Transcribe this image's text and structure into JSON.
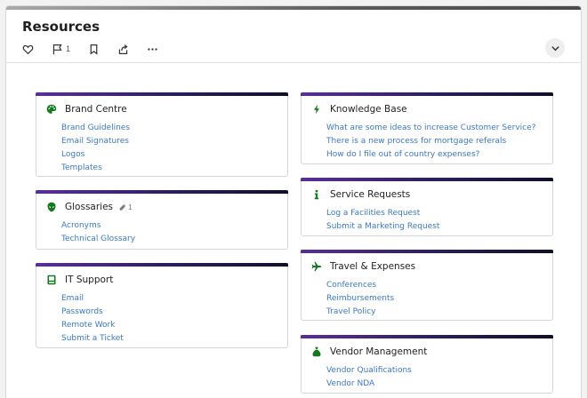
{
  "page": {
    "title": "Resources"
  },
  "actions": {
    "flag_count": "1"
  },
  "cards": {
    "brand": {
      "title": "Brand Centre",
      "links": [
        "Brand Guidelines",
        "Email Signatures",
        "Logos",
        "Templates"
      ]
    },
    "glossaries": {
      "title": "Glossaries",
      "attachment_count": "1",
      "links": [
        "Acronyms",
        "Technical Glossary"
      ]
    },
    "it": {
      "title": "IT Support",
      "links": [
        "Email",
        "Passwords",
        "Remote Work",
        "Submit a Ticket"
      ]
    },
    "knowledge": {
      "title": "Knowledge Base",
      "links": [
        "What are some ideas to increase Customer Service?",
        "There is a new process for mortgage referals",
        "How do I file out of country expenses?"
      ]
    },
    "service": {
      "title": "Service Requests",
      "links": [
        "Log a Facilities Request",
        "Submit a Marketing Request"
      ]
    },
    "travel": {
      "title": "Travel & Expenses",
      "links": [
        "Conferences",
        "Reimbursements",
        "Travel Policy"
      ]
    },
    "vendor": {
      "title": "Vendor Management",
      "links": [
        "Vendor Qualifications",
        "Vendor NDA"
      ]
    }
  },
  "colors": {
    "icon_green": "#137a1c",
    "link_blue": "#3a79c4",
    "card_accent": "#5a2e9a"
  },
  "icons": {
    "brand": "palette-icon",
    "glossaries": "alien-icon",
    "it": "terminal-icon",
    "knowledge": "bolt-icon",
    "service": "info-icon",
    "travel": "plane-icon",
    "vendor": "money-bag-icon"
  }
}
